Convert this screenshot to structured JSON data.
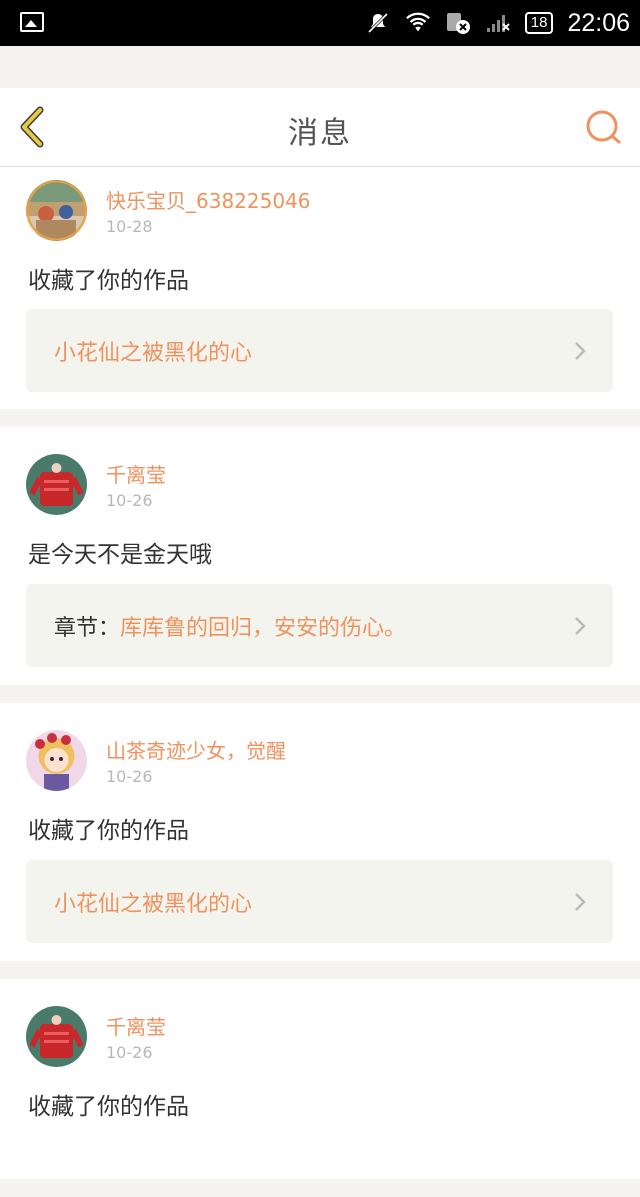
{
  "status_bar": {
    "time": "22:06",
    "battery": "18",
    "icons": [
      "image-icon",
      "mute-icon",
      "wifi-icon",
      "sim-icon",
      "signal-icon",
      "battery-icon"
    ]
  },
  "header": {
    "title": "消息",
    "back_icon": "chevron-left-icon",
    "search_icon": "search-icon"
  },
  "colors": {
    "accent": "#f0925d",
    "back_icon": "#e8c842",
    "link_bg": "#f4f4ee"
  },
  "messages": [
    {
      "user": "快乐宝贝_638225046",
      "date": "10-28",
      "text": "收藏了你的作品",
      "link_prefix": "",
      "link_text": "小花仙之被黑化的心"
    },
    {
      "user": "千离莹",
      "date": "10-26",
      "text": "是今天不是金天哦",
      "link_prefix": "章节：",
      "link_text": "库库鲁的回归，安安的伤心。"
    },
    {
      "user": "山茶奇迹少女，觉醒",
      "date": "10-26",
      "text": "收藏了你的作品",
      "link_prefix": "",
      "link_text": "小花仙之被黑化的心"
    },
    {
      "user": "千离莹",
      "date": "10-26",
      "text": "收藏了你的作品",
      "link_prefix": "",
      "link_text": ""
    }
  ]
}
